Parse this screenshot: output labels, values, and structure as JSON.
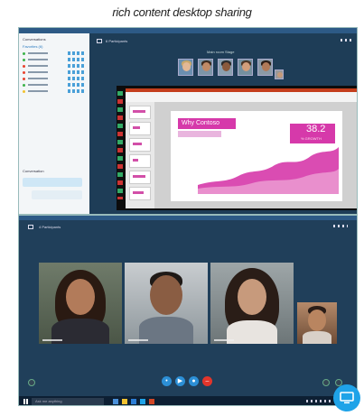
{
  "caption": "rich content desktop sharing",
  "top_window": {
    "header_label": "6 Participants",
    "stage_label": "Main room    Stage",
    "sidebar": {
      "title": "Conversations",
      "section": "Favorites (6)",
      "contacts": [
        {
          "status_color": "#3cb34a"
        },
        {
          "status_color": "#3cb34a"
        },
        {
          "status_color": "#e8432e"
        },
        {
          "status_color": "#e8432e"
        },
        {
          "status_color": "#e8432e"
        },
        {
          "status_color": "#3cb34a"
        },
        {
          "status_color": "#f2c230"
        }
      ],
      "chat_header": "Conversation"
    },
    "slide": {
      "title": "Why Contoso",
      "stat": "38.2",
      "stat_sub": "% GROWTH"
    }
  },
  "bottom_window": {
    "header_label": "4 Participants",
    "search_placeholder": "Ask me anything",
    "participants": [
      {
        "icon": "person-icon"
      },
      {
        "icon": "person-icon"
      },
      {
        "icon": "person-icon"
      },
      {
        "icon": "person-icon"
      }
    ],
    "controls": [
      {
        "icon": "chat-icon",
        "color": "#2c8fd6"
      },
      {
        "icon": "video-icon",
        "color": "#2c8fd6"
      },
      {
        "icon": "microphone-icon",
        "color": "#2c8fd6"
      },
      {
        "icon": "hang-up-icon",
        "color": "#e2352b"
      }
    ]
  },
  "colors": {
    "accent": "#1fa3e8",
    "slide_accent": "#d639aa",
    "window_bg": "#203f5a"
  }
}
